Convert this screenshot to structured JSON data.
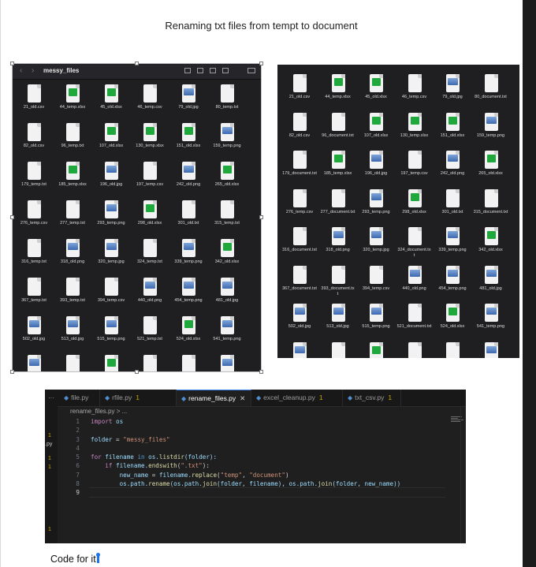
{
  "page": {
    "title": "Renaming txt files from tempt to document",
    "caption": "Code for it"
  },
  "finder_before": {
    "folder_title": "messy_files",
    "files": [
      {
        "name": "21_old.csv",
        "type": "csv"
      },
      {
        "name": "44_temp.xlsx",
        "type": "xlsx"
      },
      {
        "name": "45_old.xlsx",
        "type": "xlsx"
      },
      {
        "name": "46_temp.csv",
        "type": "csv"
      },
      {
        "name": "79_old.jpg",
        "type": "jpg"
      },
      {
        "name": "80_temp.txt",
        "type": "txt"
      },
      {
        "name": "82_old.csv",
        "type": "csv"
      },
      {
        "name": "96_temp.txt",
        "type": "txt"
      },
      {
        "name": "107_old.xlsx",
        "type": "xlsx"
      },
      {
        "name": "130_temp.xlsx",
        "type": "xlsx"
      },
      {
        "name": "151_old.xlsx",
        "type": "xlsx"
      },
      {
        "name": "159_temp.png",
        "type": "png"
      },
      {
        "name": "179_temp.txt",
        "type": "txt"
      },
      {
        "name": "185_temp.xlsx",
        "type": "xlsx"
      },
      {
        "name": "196_old.jpg",
        "type": "jpg"
      },
      {
        "name": "197_temp.csv",
        "type": "csv"
      },
      {
        "name": "242_old.png",
        "type": "png"
      },
      {
        "name": "265_old.xlsx",
        "type": "xlsx"
      },
      {
        "name": "276_temp.csv",
        "type": "csv"
      },
      {
        "name": "277_temp.txt",
        "type": "txt"
      },
      {
        "name": "293_temp.png",
        "type": "png"
      },
      {
        "name": "298_old.xlsx",
        "type": "xlsx"
      },
      {
        "name": "301_old.txt",
        "type": "txt"
      },
      {
        "name": "315_temp.txt",
        "type": "txt"
      },
      {
        "name": "316_temp.txt",
        "type": "txt"
      },
      {
        "name": "318_old.png",
        "type": "png"
      },
      {
        "name": "320_temp.jpg",
        "type": "jpg"
      },
      {
        "name": "324_temp.txt",
        "type": "txt"
      },
      {
        "name": "339_temp.png",
        "type": "png"
      },
      {
        "name": "342_old.xlsx",
        "type": "xlsx"
      },
      {
        "name": "367_temp.txt",
        "type": "txt"
      },
      {
        "name": "393_temp.txt",
        "type": "txt"
      },
      {
        "name": "394_temp.csv",
        "type": "csv"
      },
      {
        "name": "440_old.png",
        "type": "png"
      },
      {
        "name": "454_temp.png",
        "type": "png"
      },
      {
        "name": "481_old.jpg",
        "type": "jpg"
      },
      {
        "name": "502_old.jpg",
        "type": "jpg"
      },
      {
        "name": "513_old.jpg",
        "type": "jpg"
      },
      {
        "name": "515_temp.png",
        "type": "png"
      },
      {
        "name": "521_temp.txt",
        "type": "txt"
      },
      {
        "name": "524_old.xlsx",
        "type": "xlsx"
      },
      {
        "name": "541_temp.png",
        "type": "png"
      },
      {
        "name": "",
        "type": "png"
      },
      {
        "name": "",
        "type": "txt"
      },
      {
        "name": "",
        "type": "xlsx"
      },
      {
        "name": "",
        "type": "txt"
      },
      {
        "name": "",
        "type": "txt"
      },
      {
        "name": "",
        "type": "png"
      }
    ]
  },
  "finder_after": {
    "files": [
      {
        "name": "21_old.csv",
        "type": "csv"
      },
      {
        "name": "44_temp.xlsx",
        "type": "xlsx"
      },
      {
        "name": "45_old.xlsx",
        "type": "xlsx"
      },
      {
        "name": "46_temp.csv",
        "type": "csv"
      },
      {
        "name": "79_old.jpg",
        "type": "jpg"
      },
      {
        "name": "80_document.txt",
        "type": "txt"
      },
      {
        "name": "82_old.csv",
        "type": "csv"
      },
      {
        "name": "96_document.txt",
        "type": "txt"
      },
      {
        "name": "107_old.xlsx",
        "type": "xlsx"
      },
      {
        "name": "130_temp.xlsx",
        "type": "xlsx"
      },
      {
        "name": "151_old.xlsx",
        "type": "xlsx"
      },
      {
        "name": "159_temp.png",
        "type": "png"
      },
      {
        "name": "179_document.txt",
        "type": "txt"
      },
      {
        "name": "185_temp.xlsx",
        "type": "xlsx"
      },
      {
        "name": "196_old.jpg",
        "type": "jpg"
      },
      {
        "name": "197_temp.csv",
        "type": "csv"
      },
      {
        "name": "242_old.png",
        "type": "png"
      },
      {
        "name": "265_old.xlsx",
        "type": "xlsx"
      },
      {
        "name": "276_temp.csv",
        "type": "csv"
      },
      {
        "name": "277_document.txt",
        "type": "txt"
      },
      {
        "name": "293_temp.png",
        "type": "png"
      },
      {
        "name": "298_old.xlsx",
        "type": "xlsx"
      },
      {
        "name": "301_old.txt",
        "type": "txt"
      },
      {
        "name": "315_document.txt",
        "type": "txt"
      },
      {
        "name": "316_document.txt",
        "type": "txt"
      },
      {
        "name": "318_old.png",
        "type": "png"
      },
      {
        "name": "320_temp.jpg",
        "type": "jpg"
      },
      {
        "name": "324_document.tx\nt",
        "type": "txt"
      },
      {
        "name": "339_temp.png",
        "type": "png"
      },
      {
        "name": "342_old.xlsx",
        "type": "xlsx"
      },
      {
        "name": "367_document.txt",
        "type": "txt"
      },
      {
        "name": "393_document.tx\nt",
        "type": "txt"
      },
      {
        "name": "394_temp.csv",
        "type": "csv"
      },
      {
        "name": "440_old.png",
        "type": "png"
      },
      {
        "name": "454_temp.png",
        "type": "png"
      },
      {
        "name": "481_old.jpg",
        "type": "jpg"
      },
      {
        "name": "502_old.jpg",
        "type": "jpg"
      },
      {
        "name": "513_old.jpg",
        "type": "jpg"
      },
      {
        "name": "515_temp.png",
        "type": "png"
      },
      {
        "name": "521_document.txt",
        "type": "txt"
      },
      {
        "name": "524_old.xlsx",
        "type": "xlsx"
      },
      {
        "name": "541_temp.png",
        "type": "png"
      },
      {
        "name": "",
        "type": "png"
      },
      {
        "name": "",
        "type": "txt"
      },
      {
        "name": "",
        "type": "xlsx"
      },
      {
        "name": "",
        "type": "txt"
      },
      {
        "name": "",
        "type": "txt"
      },
      {
        "name": "",
        "type": "png"
      }
    ]
  },
  "editor": {
    "tabs": [
      {
        "label": "file.py",
        "badge": "",
        "active": false
      },
      {
        "label": "rfile.py",
        "badge": "1",
        "active": false
      },
      {
        "label": "rename_files.py",
        "badge": "",
        "active": true
      },
      {
        "label": "excel_cleanup.py",
        "badge": "1",
        "active": false
      },
      {
        "label": "txt_csv.py",
        "badge": "1",
        "active": false
      }
    ],
    "more_label": "···",
    "close_glyph": "✕",
    "breadcrumb": "rename_files.py > ...",
    "side_labels": [
      {
        "text": "1",
        "kind": "badge"
      },
      {
        "text": ".py",
        "kind": "file"
      },
      {
        "text": "1",
        "kind": "badge"
      },
      {
        "text": "1",
        "kind": "badge"
      },
      {
        "text": "1",
        "kind": "badge"
      }
    ],
    "lines": [
      {
        "n": "1",
        "tokens": [
          {
            "t": "import",
            "c": "kw"
          },
          {
            "t": " os",
            "c": "id"
          }
        ]
      },
      {
        "n": "2",
        "tokens": []
      },
      {
        "n": "3",
        "tokens": [
          {
            "t": "folder",
            "c": "id"
          },
          {
            "t": " = ",
            "c": "pl"
          },
          {
            "t": "\"messy_files\"",
            "c": "str"
          }
        ]
      },
      {
        "n": "4",
        "tokens": []
      },
      {
        "n": "5",
        "tokens": [
          {
            "t": "for",
            "c": "kw"
          },
          {
            "t": " filename ",
            "c": "id"
          },
          {
            "t": "in",
            "c": "kw2"
          },
          {
            "t": " os.",
            "c": "id"
          },
          {
            "t": "listdir",
            "c": "fn"
          },
          {
            "t": "(folder):",
            "c": "id"
          }
        ]
      },
      {
        "n": "6",
        "tokens": [
          {
            "t": "    if",
            "c": "kw"
          },
          {
            "t": " filename.",
            "c": "id"
          },
          {
            "t": "endswith",
            "c": "fn"
          },
          {
            "t": "(",
            "c": "pl"
          },
          {
            "t": "\".txt\"",
            "c": "str"
          },
          {
            "t": "):",
            "c": "pl"
          }
        ]
      },
      {
        "n": "7",
        "tokens": [
          {
            "t": "        new_name",
            "c": "id"
          },
          {
            "t": " = ",
            "c": "pl"
          },
          {
            "t": "filename.",
            "c": "id"
          },
          {
            "t": "replace",
            "c": "fn"
          },
          {
            "t": "(",
            "c": "pl"
          },
          {
            "t": "\"temp\"",
            "c": "str"
          },
          {
            "t": ", ",
            "c": "pl"
          },
          {
            "t": "\"document\"",
            "c": "str"
          },
          {
            "t": ")",
            "c": "pl"
          }
        ]
      },
      {
        "n": "8",
        "tokens": [
          {
            "t": "        os.path.",
            "c": "id"
          },
          {
            "t": "rename",
            "c": "fn"
          },
          {
            "t": "(os.path.",
            "c": "id"
          },
          {
            "t": "join",
            "c": "fn"
          },
          {
            "t": "(folder, filename), os.path.",
            "c": "id"
          },
          {
            "t": "join",
            "c": "fn"
          },
          {
            "t": "(folder, new_name))",
            "c": "id"
          }
        ]
      },
      {
        "n": "9",
        "tokens": []
      }
    ]
  }
}
